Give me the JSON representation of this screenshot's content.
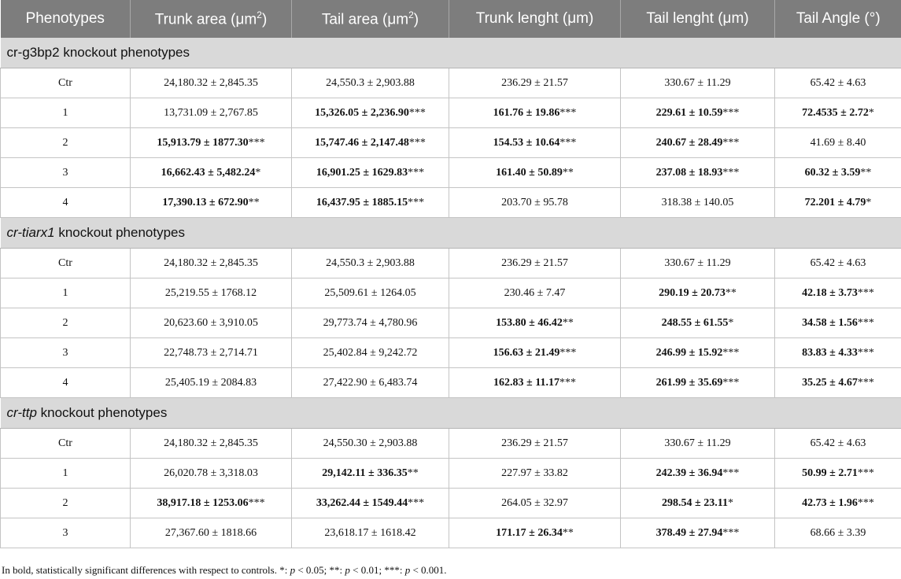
{
  "table": {
    "headers": [
      "Phenotypes",
      "Trunk area (μm",
      "Tail area (μm",
      "Trunk lenght (μm)",
      "Tail lenght (μm)",
      "Tail Angle (°)"
    ],
    "header_sup": [
      "",
      "2",
      "2",
      "",
      "",
      ""
    ],
    "header_suffix": [
      "",
      ")",
      ")",
      "",
      "",
      ""
    ],
    "sections": [
      {
        "prefix": "cr-g3bp2",
        "suffix": " knockout phenotypes",
        "italic": false,
        "rows": [
          {
            "cells": [
              {
                "v": "Ctr",
                "s": ""
              },
              {
                "v": "24,180.32 ± 2,845.35",
                "s": ""
              },
              {
                "v": "24,550.3 ± 2,903.88",
                "s": ""
              },
              {
                "v": "236.29 ± 21.57",
                "s": ""
              },
              {
                "v": "330.67 ± 11.29",
                "s": ""
              },
              {
                "v": "65.42 ± 4.63",
                "s": ""
              }
            ]
          },
          {
            "cells": [
              {
                "v": "1",
                "s": ""
              },
              {
                "v": "13,731.09 ± 2,767.85",
                "s": ""
              },
              {
                "v": "15,326.05 ± 2,236.90",
                "s": "***",
                "bold": true
              },
              {
                "v": "161.76 ± 19.86",
                "s": "***",
                "bold": true
              },
              {
                "v": "229.61 ± 10.59",
                "s": "***",
                "bold": true
              },
              {
                "v": "72.4535 ± 2.72",
                "s": "*",
                "bold": true
              }
            ]
          },
          {
            "cells": [
              {
                "v": "2",
                "s": ""
              },
              {
                "v": "15,913.79 ± 1877.30",
                "s": "***",
                "bold": true
              },
              {
                "v": "15,747.46 ± 2,147.48",
                "s": "***",
                "bold": true
              },
              {
                "v": "154.53 ± 10.64",
                "s": "***",
                "bold": true
              },
              {
                "v": "240.67 ± 28.49",
                "s": "***",
                "bold": true
              },
              {
                "v": "41.69 ± 8.40",
                "s": ""
              }
            ]
          },
          {
            "cells": [
              {
                "v": "3",
                "s": ""
              },
              {
                "v": "16,662.43 ± 5,482.24",
                "s": "*",
                "bold": true
              },
              {
                "v": "16,901.25 ± 1629.83",
                "s": "***",
                "bold": true
              },
              {
                "v": "161.40 ± 50.89",
                "s": "**",
                "bold": true
              },
              {
                "v": "237.08 ± 18.93",
                "s": "***",
                "bold": true
              },
              {
                "v": "60.32 ± 3.59",
                "s": "**",
                "bold": true
              }
            ]
          },
          {
            "cells": [
              {
                "v": "4",
                "s": ""
              },
              {
                "v": "17,390.13 ± 672.90",
                "s": "**",
                "bold": true
              },
              {
                "v": "16,437.95 ± 1885.15",
                "s": "***",
                "bold": true
              },
              {
                "v": "203.70 ± 95.78",
                "s": ""
              },
              {
                "v": "318.38 ± 140.05",
                "s": ""
              },
              {
                "v": "72.201 ± 4.79",
                "s": "*",
                "bold": true
              }
            ]
          }
        ]
      },
      {
        "prefix": "cr-tiarx1",
        "suffix": " knockout phenotypes",
        "italic": true,
        "rows": [
          {
            "cells": [
              {
                "v": "Ctr",
                "s": ""
              },
              {
                "v": "24,180.32 ± 2,845.35",
                "s": ""
              },
              {
                "v": "24,550.3 ± 2,903.88",
                "s": ""
              },
              {
                "v": "236.29 ± 21.57",
                "s": ""
              },
              {
                "v": "330.67 ± 11.29",
                "s": ""
              },
              {
                "v": "65.42 ± 4.63",
                "s": ""
              }
            ]
          },
          {
            "cells": [
              {
                "v": "1",
                "s": ""
              },
              {
                "v": "25,219.55 ± 1768.12",
                "s": ""
              },
              {
                "v": "25,509.61 ± 1264.05",
                "s": ""
              },
              {
                "v": "230.46 ± 7.47",
                "s": ""
              },
              {
                "v": "290.19 ± 20.73",
                "s": "**",
                "bold": true
              },
              {
                "v": "42.18 ± 3.73",
                "s": "***",
                "bold": true
              }
            ]
          },
          {
            "cells": [
              {
                "v": "2",
                "s": ""
              },
              {
                "v": "20,623.60 ± 3,910.05",
                "s": ""
              },
              {
                "v": "29,773.74 ± 4,780.96",
                "s": ""
              },
              {
                "v": "153.80 ± 46.42",
                "s": "**",
                "bold": true
              },
              {
                "v": "248.55 ± 61.55",
                "s": "*",
                "bold": true
              },
              {
                "v": "34.58 ± 1.56",
                "s": "***",
                "bold": true
              }
            ]
          },
          {
            "cells": [
              {
                "v": "3",
                "s": ""
              },
              {
                "v": "22,748.73 ± 2,714.71",
                "s": ""
              },
              {
                "v": "25,402.84 ± 9,242.72",
                "s": ""
              },
              {
                "v": "156.63 ± 21.49",
                "s": "***",
                "bold": true
              },
              {
                "v": "246.99 ± 15.92",
                "s": "***",
                "bold": true
              },
              {
                "v": "83.83 ± 4.33",
                "s": "***",
                "bold": true
              }
            ]
          },
          {
            "cells": [
              {
                "v": "4",
                "s": ""
              },
              {
                "v": "25,405.19 ± 2084.83",
                "s": ""
              },
              {
                "v": "27,422.90 ± 6,483.74",
                "s": ""
              },
              {
                "v": "162.83 ± 11.17",
                "s": "***",
                "bold": true
              },
              {
                "v": "261.99 ± 35.69",
                "s": "***",
                "bold": true
              },
              {
                "v": "35.25 ± 4.67",
                "s": "***",
                "bold": true
              }
            ]
          }
        ]
      },
      {
        "prefix": "cr-ttp",
        "suffix": " knockout phenotypes",
        "italic": true,
        "rows": [
          {
            "cells": [
              {
                "v": "Ctr",
                "s": ""
              },
              {
                "v": "24,180.32 ± 2,845.35",
                "s": ""
              },
              {
                "v": "24,550.30 ± 2,903.88",
                "s": ""
              },
              {
                "v": "236.29 ± 21.57",
                "s": ""
              },
              {
                "v": "330.67 ± 11.29",
                "s": ""
              },
              {
                "v": "65.42 ± 4.63",
                "s": ""
              }
            ]
          },
          {
            "cells": [
              {
                "v": "1",
                "s": ""
              },
              {
                "v": "26,020.78 ± 3,318.03",
                "s": ""
              },
              {
                "v": "29,142.11 ± 336.35",
                "s": "**",
                "bold": true
              },
              {
                "v": "227.97 ± 33.82",
                "s": ""
              },
              {
                "v": "242.39 ± 36.94",
                "s": "***",
                "bold": true
              },
              {
                "v": "50.99 ± 2.71",
                "s": "***",
                "bold": true
              }
            ]
          },
          {
            "cells": [
              {
                "v": "2",
                "s": ""
              },
              {
                "v": "38,917.18 ± 1253.06",
                "s": "***",
                "bold": true
              },
              {
                "v": "33,262.44 ± 1549.44",
                "s": "***",
                "bold": true
              },
              {
                "v": "264.05 ± 32.97",
                "s": ""
              },
              {
                "v": "298.54 ± 23.11",
                "s": "*",
                "bold": true
              },
              {
                "v": "42.73 ± 1.96",
                "s": "***",
                "bold": true
              }
            ]
          },
          {
            "cells": [
              {
                "v": "3",
                "s": ""
              },
              {
                "v": "27,367.60 ± 1818.66",
                "s": ""
              },
              {
                "v": "23,618.17 ± 1618.42",
                "s": ""
              },
              {
                "v": "171.17 ± 26.34",
                "s": "**",
                "bold": true
              },
              {
                "v": "378.49 ± 27.94",
                "s": "***",
                "bold": true
              },
              {
                "v": "68.66 ± 3.39",
                "s": ""
              }
            ]
          }
        ]
      }
    ]
  },
  "footnote": {
    "lead": "In bold, statistically significant differences with respect to controls. *: ",
    "parts": [
      {
        "p": "p",
        "t": " < 0.05; **: "
      },
      {
        "p": "p",
        "t": " < 0.01; ***: "
      },
      {
        "p": "p",
        "t": " < 0.001."
      }
    ]
  }
}
